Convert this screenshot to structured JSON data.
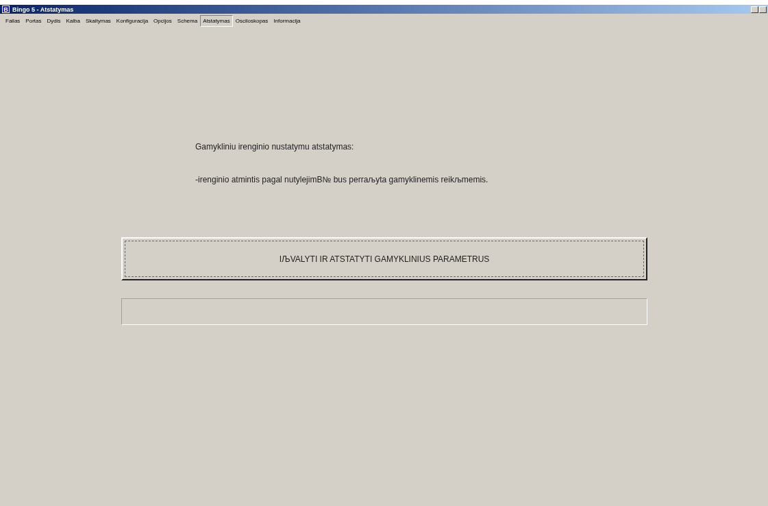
{
  "window": {
    "title": "Bingo 5 - Atstatymas",
    "icon_letter": "B"
  },
  "tabs": [
    {
      "label": "Failas",
      "selected": false
    },
    {
      "label": "Portas",
      "selected": false
    },
    {
      "label": "Dydis",
      "selected": false
    },
    {
      "label": "Kalba",
      "selected": false
    },
    {
      "label": "Skaitymas",
      "selected": false
    },
    {
      "label": "Konfiguracija",
      "selected": false
    },
    {
      "label": "Opcijos",
      "selected": false
    },
    {
      "label": "Schema",
      "selected": false
    },
    {
      "label": "Atstatymas",
      "selected": true
    },
    {
      "label": "Osciloskopas",
      "selected": false
    },
    {
      "label": "Informacija",
      "selected": false
    }
  ],
  "content": {
    "heading": "Gamykliniu irenginio nustatymu atstatymas:",
    "description": "-irenginio atmintis pagal nutylejimВ№ bus perraљyta gamyklinemis reikљmemis.",
    "reset_button": "IЉVALYTI IR ATSTATYTI GAMYKLINIUS PARAMETRUS"
  }
}
